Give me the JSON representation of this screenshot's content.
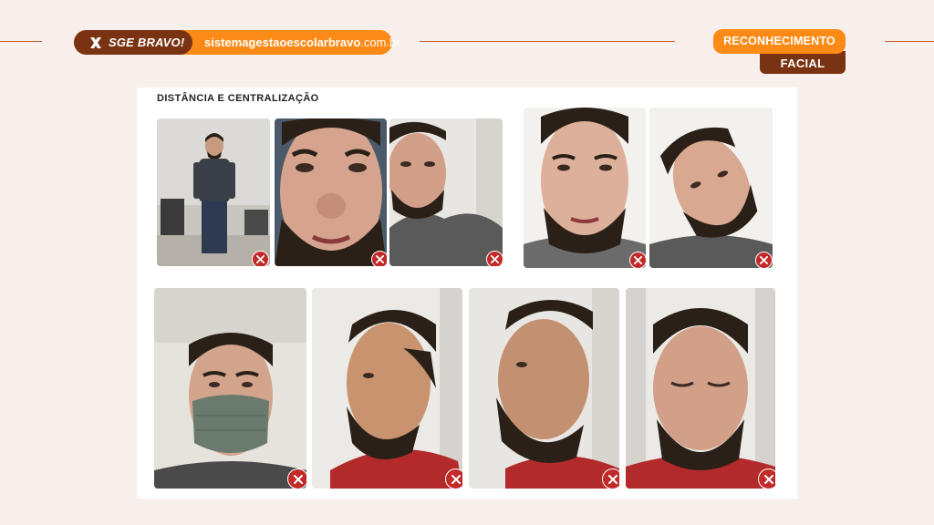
{
  "header": {
    "brand_name": "SGE BRAVO!",
    "url_bold": "sistemagestaoescolarbravo",
    "url_suffix": ".com.br",
    "title_line1": "RECONHECIMENTO",
    "title_line2": "FACIAL"
  },
  "card": {
    "heading": "DISTÂNCIA E CENTRALIZAÇÃO"
  },
  "icons": {
    "brand": "sge-x-logo-icon",
    "reject": "reject-x-icon"
  },
  "colors": {
    "background": "#f7efeb",
    "orange": "#fb8a16",
    "brown": "#7a3312",
    "reject_red": "#c22a2a"
  }
}
